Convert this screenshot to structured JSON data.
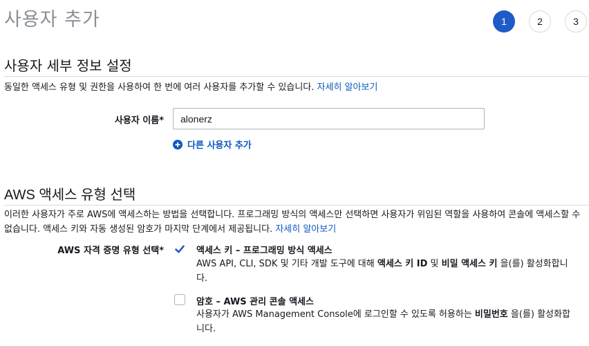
{
  "header": {
    "title": "사용자 추가",
    "steps": [
      "1",
      "2",
      "3"
    ],
    "active_step": "1"
  },
  "details": {
    "section_title": "사용자 세부 정보 설정",
    "description": "동일한 액세스 유형 및 권한을 사용하여 한 번에 여러 사용자를 추가할 수 있습니다.",
    "learn_more": "자세히 알아보기",
    "username_label": "사용자 이름*",
    "username_value": "alonerz",
    "add_user_label": "다른 사용자 추가"
  },
  "access": {
    "section_title": "AWS 액세스 유형 선택",
    "description": "이러한 사용자가 주로 AWS에 액세스하는 방법을 선택합니다. 프로그래밍 방식의 액세스만 선택하면 사용자가 위임된 역할을 사용하여 콘솔에 액세스할 수 없습니다. 액세스 키와 자동 생성된 암호가 마지막 단계에서 제공됩니다.",
    "learn_more": "자세히 알아보기",
    "credential_label": "AWS 자격 증명 유형 선택*",
    "options": [
      {
        "title": "액세스 키 – 프로그래밍 방식 액세스",
        "checked": true,
        "desc_prefix": "AWS API, CLI, SDK 및 기타 개발 도구에 대해 ",
        "desc_bold_1": "액세스 키 ID",
        "desc_mid": " 및 ",
        "desc_bold_2": "비밀 액세스 키",
        "desc_suffix": " 을(를) 활성화합니다."
      },
      {
        "title": "암호 – AWS 관리 콘솔 액세스",
        "checked": false,
        "desc_prefix": "사용자가 AWS Management Console에 로그인할 수 있도록 허용하는 ",
        "desc_bold": "비밀번호",
        "desc_suffix": " 을(를) 활성화합니다."
      }
    ]
  },
  "colors": {
    "accent": "#1e5bc6",
    "link": "#0a59c0",
    "divider": "#d5dbdb",
    "muted_title": "#8a8f96"
  }
}
